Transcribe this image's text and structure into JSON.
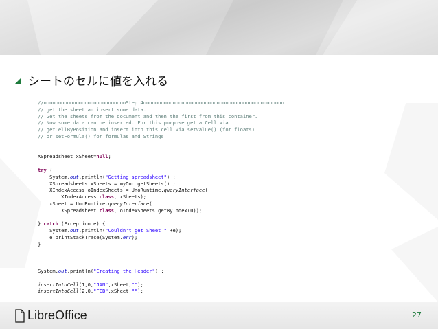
{
  "slide": {
    "heading": "シートのセルに値を入れる",
    "page_number": "27",
    "logo": {
      "word1": "Libre",
      "word2": "Office"
    },
    "accent_color": "#1e7b3c",
    "icon": "triangle-bullet-icon"
  },
  "code": [
    [
      {
        "t": "//ooooooooooooooooooooooooooooStep 4oooooooooooooooooooooooooooooooooooooooooooooooo",
        "c": "cm"
      }
    ],
    [
      {
        "t": "// get the sheet an insert some data.",
        "c": "cm"
      }
    ],
    [
      {
        "t": "// Get the sheets from the document and then the first from this container.",
        "c": "cm"
      }
    ],
    [
      {
        "t": "// Now some data can be inserted. For this purpose get a Cell via",
        "c": "cm"
      }
    ],
    [
      {
        "t": "// getCellByPosition and insert into this cell via setValue() (for floats)",
        "c": "cm"
      }
    ],
    [
      {
        "t": "// or setFormula() for formulas and Strings",
        "c": "cm"
      }
    ],
    [],
    [],
    [
      {
        "t": "XSpreadsheet xSheet="
      },
      {
        "t": "null",
        "c": "kw"
      },
      {
        "t": ";"
      }
    ],
    [],
    [
      {
        "t": "try",
        "c": "kw"
      },
      {
        "t": " {"
      }
    ],
    [
      {
        "t": "    System."
      },
      {
        "t": "out",
        "c": "fd"
      },
      {
        "t": ".println("
      },
      {
        "t": "\"Getting spreadsheet\"",
        "c": "st"
      },
      {
        "t": ") ;"
      }
    ],
    [
      {
        "t": "    XSpreadsheets xSheets = myDoc.getSheets() ;"
      }
    ],
    [
      {
        "t": "    XIndexAccess oIndexSheets = UnoRuntime."
      },
      {
        "t": "queryInterface",
        "c": "it"
      },
      {
        "t": "("
      }
    ],
    [
      {
        "t": "        XIndexAccess."
      },
      {
        "t": "class",
        "c": "kw"
      },
      {
        "t": ", xSheets);"
      }
    ],
    [
      {
        "t": "    xSheet = UnoRuntime."
      },
      {
        "t": "queryInterface",
        "c": "it"
      },
      {
        "t": "("
      }
    ],
    [
      {
        "t": "        XSpreadsheet."
      },
      {
        "t": "class",
        "c": "kw"
      },
      {
        "t": ", oIndexSheets.getByIndex(0));"
      }
    ],
    [],
    [
      {
        "t": "} "
      },
      {
        "t": "catch",
        "c": "kw"
      },
      {
        "t": " (Exception e) {"
      }
    ],
    [
      {
        "t": "    System."
      },
      {
        "t": "out",
        "c": "fd"
      },
      {
        "t": ".println("
      },
      {
        "t": "\"Couldn't get Sheet \"",
        "c": "st"
      },
      {
        "t": " +e);"
      }
    ],
    [
      {
        "t": "    e.printStackTrace(System."
      },
      {
        "t": "err",
        "c": "fd"
      },
      {
        "t": ");"
      }
    ],
    [
      {
        "t": "}"
      }
    ],
    [],
    [],
    [],
    [
      {
        "t": "System."
      },
      {
        "t": "out",
        "c": "fd"
      },
      {
        "t": ".println("
      },
      {
        "t": "\"Creating the Header\"",
        "c": "st"
      },
      {
        "t": ") ;"
      }
    ],
    [],
    [
      {
        "t": "insertIntoCell",
        "c": "it"
      },
      {
        "t": "(1,0,"
      },
      {
        "t": "\"JAN\"",
        "c": "st"
      },
      {
        "t": ",xSheet,"
      },
      {
        "t": "\"\"",
        "c": "st"
      },
      {
        "t": ");"
      }
    ],
    [
      {
        "t": "insertIntoCell",
        "c": "it"
      },
      {
        "t": "(2,0,"
      },
      {
        "t": "\"FEB\"",
        "c": "st"
      },
      {
        "t": ",xSheet,"
      },
      {
        "t": "\"\"",
        "c": "st"
      },
      {
        "t": ");"
      }
    ]
  ]
}
